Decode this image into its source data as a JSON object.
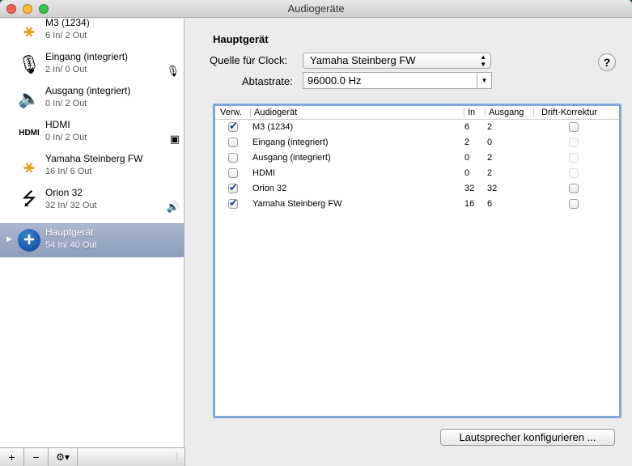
{
  "window": {
    "title": "Audiogeräte"
  },
  "sidebar": {
    "devices": [
      {
        "name": "M3 (1234)",
        "io": "6 In/ 2 Out",
        "icon": "firewire-icon",
        "badge": ""
      },
      {
        "name": "Eingang (integriert)",
        "io": "2 In/ 0 Out",
        "icon": "microphone-icon",
        "badge": "🎙"
      },
      {
        "name": "Ausgang (integriert)",
        "io": "0 In/ 2 Out",
        "icon": "speaker-icon",
        "badge": ""
      },
      {
        "name": "HDMI",
        "io": "0 In/ 2 Out",
        "icon": "hdmi-icon",
        "badge": "▣"
      },
      {
        "name": "Yamaha Steinberg FW",
        "io": "16 In/ 6 Out",
        "icon": "firewire-icon",
        "badge": ""
      },
      {
        "name": "Orion 32",
        "io": "32 In/ 32 Out",
        "icon": "usb-icon",
        "badge": "🔊"
      },
      {
        "name": "Hauptgerät",
        "io": "54 In/ 40 Out",
        "icon": "aggregate-plus-icon",
        "badge": ""
      }
    ],
    "hdmi_logo": "HDMI",
    "bottom": {
      "add": "+",
      "remove": "−",
      "gear": "⚙▾"
    }
  },
  "main": {
    "heading": "Hauptgerät",
    "clock_label": "Quelle für Clock:",
    "clock_value": "Yamaha Steinberg FW",
    "rate_label": "Abtastrate:",
    "rate_value": "96000.0 Hz",
    "help": "?",
    "columns": [
      "Verw.",
      "Audiogerät",
      "In",
      "Ausgang",
      "Drift-Korrektur"
    ],
    "rows": [
      {
        "use": true,
        "name": "M3 (1234)",
        "in": "6",
        "out": "2",
        "drift": false,
        "drift_enabled": true
      },
      {
        "use": false,
        "name": "Eingang (integriert)",
        "in": "2",
        "out": "0",
        "drift": false,
        "drift_enabled": false
      },
      {
        "use": false,
        "name": "Ausgang (integriert)",
        "in": "0",
        "out": "2",
        "drift": false,
        "drift_enabled": false
      },
      {
        "use": false,
        "name": "HDMI",
        "in": "0",
        "out": "2",
        "drift": false,
        "drift_enabled": false
      },
      {
        "use": true,
        "name": "Orion 32",
        "in": "32",
        "out": "32",
        "drift": false,
        "drift_enabled": true
      },
      {
        "use": true,
        "name": "Yamaha Steinberg FW",
        "in": "16",
        "out": "6",
        "drift": false,
        "drift_enabled": true
      }
    ],
    "configure_button": "Lautsprecher konfigurieren ..."
  }
}
